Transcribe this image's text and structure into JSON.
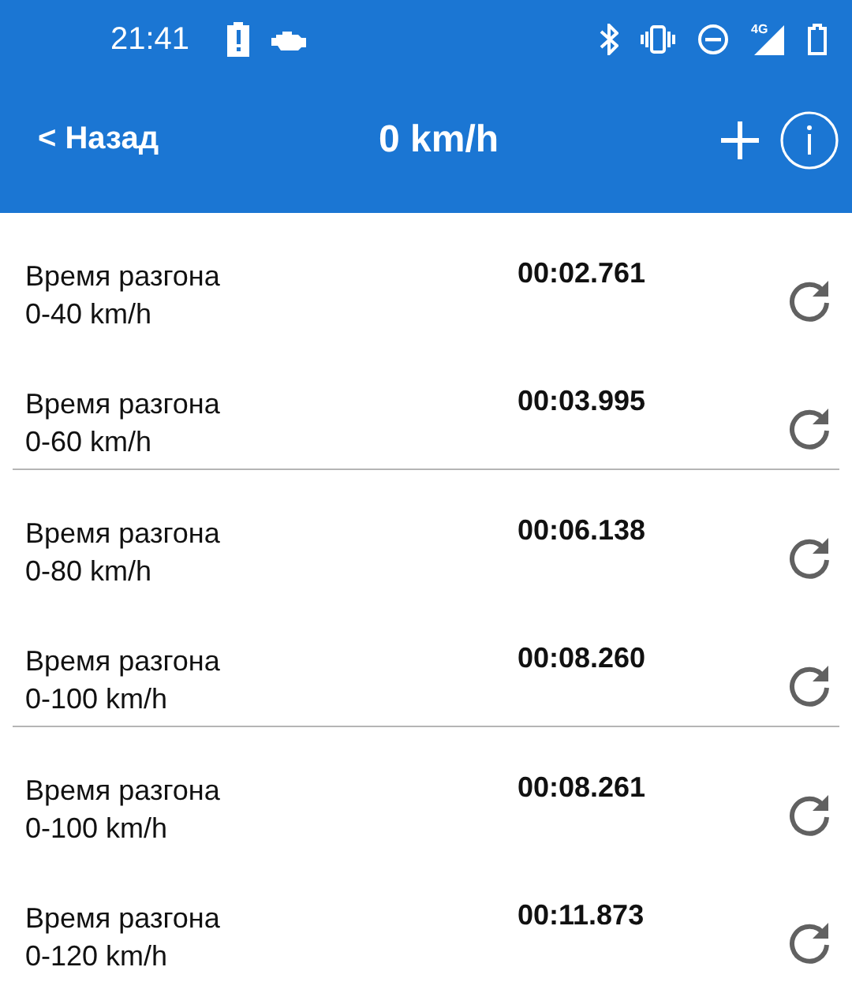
{
  "status_bar": {
    "time": "21:41",
    "network": "4G"
  },
  "header": {
    "back": "< Назад",
    "title": "0 km/h"
  },
  "groups": [
    {
      "rows": [
        {
          "title": "Время разгона",
          "range": "0-40 km/h",
          "time": "00:02.761"
        },
        {
          "title": "Время разгона",
          "range": "0-60 km/h",
          "time": "00:03.995"
        }
      ]
    },
    {
      "rows": [
        {
          "title": "Время разгона",
          "range": "0-80 km/h",
          "time": "00:06.138"
        },
        {
          "title": "Время разгона",
          "range": "0-100 km/h",
          "time": "00:08.260"
        }
      ]
    },
    {
      "rows": [
        {
          "title": "Время разгона",
          "range": "0-100 km/h",
          "time": "00:08.261"
        },
        {
          "title": "Время разгона",
          "range": "0-120 km/h",
          "time": "00:11.873"
        }
      ]
    }
  ]
}
